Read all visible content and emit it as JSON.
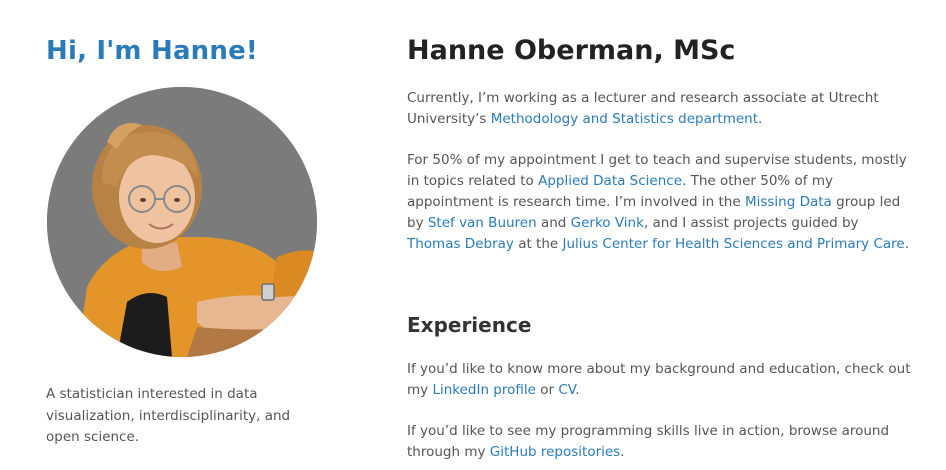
{
  "sidebar": {
    "greeting": "Hi, I'm Hanne!",
    "tagline": "A statistician interested in data visualization, interdisciplinarity, and open science."
  },
  "main": {
    "name": "Hanne Oberman, MSc",
    "intro": {
      "t1": "Currently, I’m working as a lecturer and research associate at Utrecht University’s ",
      "link_dept": "Methodology and Statistics department",
      "t2": "."
    },
    "appointment": {
      "t1": "For 50% of my appointment I get to teach and supervise students, mostly in topics related to ",
      "link_ads": "Applied Data Science",
      "t2": ". The other 50% of my appointment is research time. I’m involved in the ",
      "link_missing": "Missing Data",
      "t3": " group led by ",
      "link_stef": "Stef van Buuren",
      "t4": " and ",
      "link_gerko": "Gerko Vink",
      "t5": ", and I assist projects guided by ",
      "link_thomas": "Thomas Debray",
      "t6": " at the ",
      "link_julius": "Julius Center for Health Sciences and Primary Care",
      "t7": "."
    },
    "experience": {
      "title": "Experience",
      "background": {
        "t1": "If you’d like to know more about my background and education, check out my ",
        "link_linkedin": "LinkedIn profile",
        "t2": " or ",
        "link_cv": "CV",
        "t3": "."
      },
      "programming": {
        "t1": "If you’d like to see my programming skills live in action, browse around through my ",
        "link_github": "GitHub repositories",
        "t2": "."
      }
    }
  },
  "colors": {
    "accent": "#2b7bb9",
    "heading": "#222222",
    "text": "#555555",
    "photo_background": "#7b7b7b"
  }
}
